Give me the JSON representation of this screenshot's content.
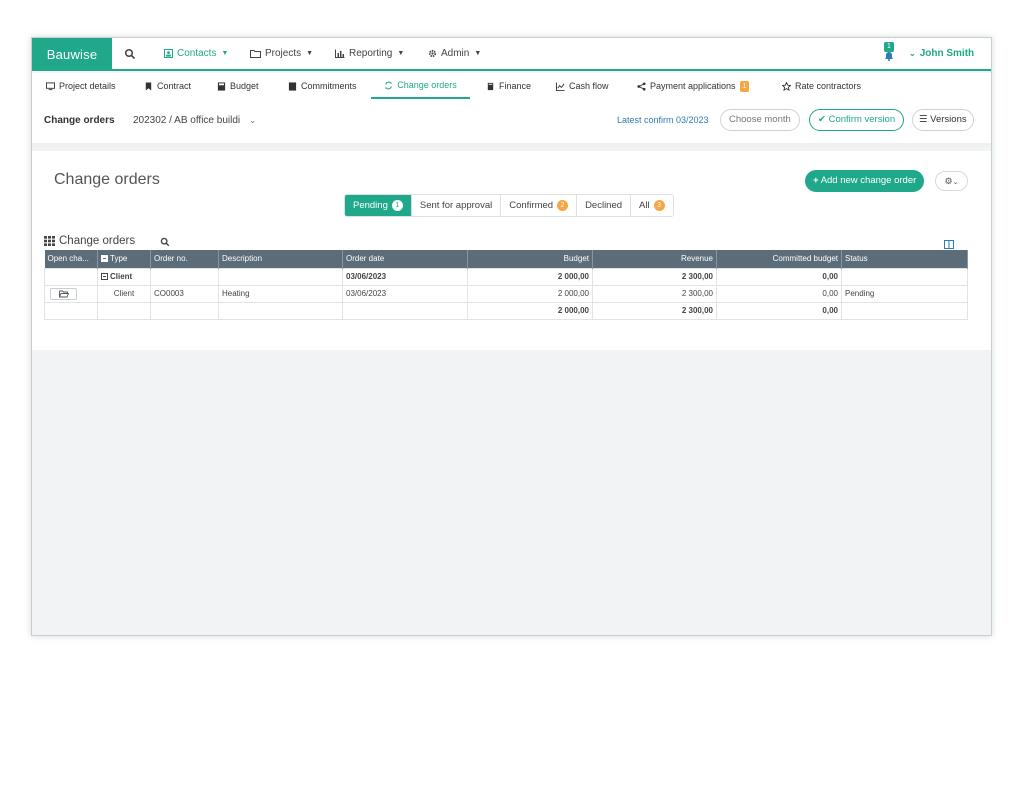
{
  "brand": "Bauwise",
  "nav": {
    "contacts": "Contacts",
    "projects": "Projects",
    "reporting": "Reporting",
    "admin": "Admin",
    "notification_count": "1",
    "user": "John Smith"
  },
  "tabs": {
    "project_details": "Project details",
    "contract": "Contract",
    "budget": "Budget",
    "commitments": "Commitments",
    "change_orders": "Change orders",
    "finance": "Finance",
    "cash_flow": "Cash flow",
    "payment_applications": "Payment applications",
    "payment_applications_count": "1",
    "rate_contractors": "Rate contractors"
  },
  "header": {
    "label": "Change orders",
    "project": "202302 / AB office buildi",
    "latest_confirm": "Latest confirm 03/2023",
    "choose_month": "Choose month",
    "confirm_version": "Confirm version",
    "versions": "Versions"
  },
  "content": {
    "title": "Change orders",
    "add_button": "Add new change order",
    "filters": {
      "pending": "Pending",
      "pending_count": "1",
      "sent": "Sent for approval",
      "confirmed": "Confirmed",
      "confirmed_count": "2",
      "declined": "Declined",
      "all": "All",
      "all_count": "3"
    },
    "grid_title": "Change orders"
  },
  "table": {
    "headers": {
      "open": "Open cha...",
      "type": "Type",
      "order_no": "Order no.",
      "description": "Description",
      "order_date": "Order date",
      "budget": "Budget",
      "revenue": "Revenue",
      "committed": "Committed budget",
      "status": "Status"
    },
    "group": {
      "type": "Client",
      "order_date": "03/06/2023",
      "budget": "2 000,00",
      "revenue": "2 300,00",
      "committed": "0,00"
    },
    "row": {
      "type": "Client",
      "order_no": "CO0003",
      "description": "Heating",
      "order_date": "03/06/2023",
      "budget": "2 000,00",
      "revenue": "2 300,00",
      "committed": "0,00",
      "status": "Pending"
    },
    "total": {
      "budget": "2 000,00",
      "revenue": "2 300,00",
      "committed": "0,00"
    }
  },
  "colors": {
    "accent": "#1fa88a",
    "table_header": "#5c6d79",
    "badge": "#f4a742",
    "link": "#2a7db6"
  }
}
